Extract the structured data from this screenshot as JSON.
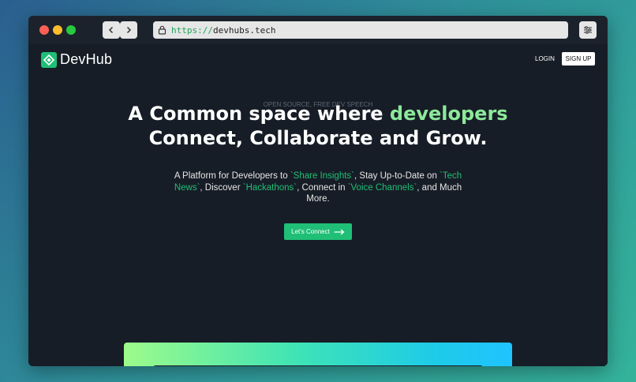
{
  "browser": {
    "url_scheme": "https://",
    "url_host": "devhubs.tech"
  },
  "nav": {
    "logo_text": "DevHub",
    "login_label": "LOGIN",
    "signup_label": "SIGN UP"
  },
  "hero": {
    "eyebrow": "OPEN SOURCE, FREE DEV SPEECH",
    "headline_part1": "A Common space where ",
    "headline_accent": "developers",
    "headline_line2": "Connect, Collaborate and Grow.",
    "desc_1": "A Platform for Developers to ",
    "desc_hl1": "`Share Insights`",
    "desc_2": ", Stay Up-to-Date on ",
    "desc_hl2": "`Tech News`",
    "desc_3": ", Discover ",
    "desc_hl3": "`Hackathons`",
    "desc_4": ", Connect in ",
    "desc_hl4": "`Voice Channels`",
    "desc_5": ", and Much More.",
    "cta_label": "Let's Connect"
  },
  "colors": {
    "accent": "#1fbf77",
    "headline_accent": "#8ce99a",
    "background": "#171d26"
  }
}
